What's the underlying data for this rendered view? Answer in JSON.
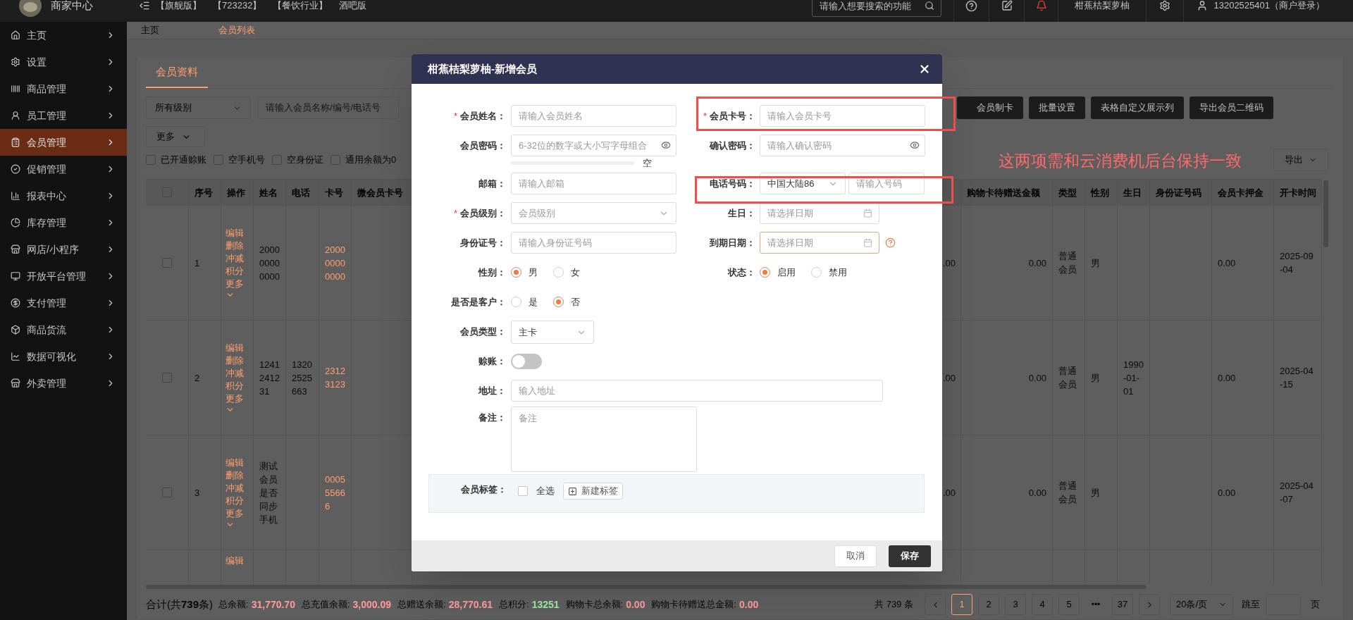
{
  "topbar": {
    "brand": "商家中心",
    "tags": [
      "【旗舰版】",
      "【723232】",
      "【餐饮行业】",
      "酒吧版"
    ],
    "search": {
      "placeholder": "请输入想要搜索的功能"
    },
    "store": "柑蕉桔梨萝柚",
    "user": "13202525401（商户登录）"
  },
  "sidebar": {
    "items": [
      {
        "label": "主页",
        "selected": false
      },
      {
        "label": "设置",
        "selected": false
      },
      {
        "label": "商品管理",
        "selected": false
      },
      {
        "label": "员工管理",
        "selected": false
      },
      {
        "label": "会员管理",
        "selected": true
      },
      {
        "label": "促销管理",
        "selected": false
      },
      {
        "label": "报表中心",
        "selected": false
      },
      {
        "label": "库存管理",
        "selected": false
      },
      {
        "label": "网店/小程序",
        "selected": false
      },
      {
        "label": "开放平台管理",
        "selected": false
      },
      {
        "label": "支付管理",
        "selected": false
      },
      {
        "label": "商品货流",
        "selected": false
      },
      {
        "label": "数据可视化",
        "selected": false
      },
      {
        "label": "外卖管理",
        "selected": false
      }
    ]
  },
  "breadcrumb": [
    {
      "label": "主页",
      "selected": false
    },
    {
      "label": "会员列表",
      "selected": true
    }
  ],
  "tabs": [
    {
      "label": "会员资料",
      "selected": true
    }
  ],
  "filters": {
    "level": "所有级别",
    "search": {
      "placeholder": "请输入会员名称/编号/电话号"
    },
    "more": "更多",
    "checks": [
      {
        "label": "已开通赊账",
        "checked": false
      },
      {
        "label": "空手机号",
        "checked": false
      },
      {
        "label": "空身份证",
        "checked": false
      },
      {
        "label": "通用余额为0",
        "checked": false
      }
    ]
  },
  "actions": [
    "会员制卡",
    "批量设置",
    "表格自定义展示列",
    "导出会员二维码"
  ],
  "export": "导出",
  "annotation": "这两项需和云消费机后台保持一致",
  "table": {
    "all_checked": false,
    "left_columns": [
      "序号",
      "操作",
      "姓名",
      "电话",
      "卡号",
      "微会员卡号"
    ],
    "right_columns": [
      "购物卡待赠送金额",
      "类型",
      "性别",
      "生日",
      "身份证号码",
      "会员卡押金",
      "开卡时间"
    ],
    "rows": [
      {
        "checked": false,
        "no": "1",
        "actions": [
          "编辑",
          "删除",
          "冲减积分",
          "更多"
        ],
        "more_menu": true,
        "name": "200000000000",
        "card": "200000000000",
        "partial": ".00",
        "gift": "0.00",
        "type": "普通会员",
        "gender": "男",
        "deposit": "0.00",
        "opened": "2025-09-04"
      },
      {
        "checked": false,
        "no": "2",
        "actions": [
          "编辑",
          "删除",
          "冲减积分",
          "更多"
        ],
        "more_menu": true,
        "name": "1241241231",
        "phone": "13202525663",
        "card": "23123123",
        "partial": ".00",
        "gift": "0.00",
        "type": "普通会员",
        "gender": "男",
        "birthday": "1990-01-01",
        "deposit": "0.00",
        "opened": "2025-04-15"
      },
      {
        "checked": false,
        "no": "3",
        "actions": [
          "编辑",
          "删除",
          "冲减积分",
          "更多"
        ],
        "more_menu": true,
        "name": "测试会员是否同步手机",
        "card": "000555666",
        "partial": ".00",
        "gift": "0.00",
        "type": "普通会员",
        "gender": "男",
        "deposit": "0.00",
        "opened": "2025-04-07"
      },
      {
        "actions": [
          "编辑"
        ]
      }
    ]
  },
  "footer": {
    "total": "合计(共**739**条)",
    "sums": [
      {
        "label": "总余额:",
        "value": "31,770.70",
        "color": "#ff9a9a"
      },
      {
        "label": "总充值余额:",
        "value": "3,000.09",
        "color": "#ff9a9a"
      },
      {
        "label": "总赠送余额:",
        "value": "28,770.61",
        "color": "#ff9a9a"
      },
      {
        "label": "总积分:",
        "value": "13251",
        "color": "#9fe6a0"
      },
      {
        "label": "购物卡总余额:",
        "value": "0.00",
        "color": "#ff9a9a"
      },
      {
        "label": "购物卡待赠送总金额:",
        "value": "0.00",
        "color": "#ff9a9a"
      }
    ],
    "pagination": {
      "count": "共 739 条",
      "pages": [
        {
          "kind": "page",
          "label": "1",
          "selected": true
        },
        {
          "kind": "page",
          "label": "2",
          "selected": false
        },
        {
          "kind": "page",
          "label": "3",
          "selected": false
        },
        {
          "kind": "page",
          "label": "4",
          "selected": false
        },
        {
          "kind": "page",
          "label": "5",
          "selected": false
        },
        {
          "kind": "ellipsis",
          "label": "•••",
          "selected": false
        },
        {
          "kind": "page",
          "label": "37",
          "selected": false
        }
      ],
      "page_size": "20条/页",
      "jump_label": "跳至",
      "page_unit": "页"
    }
  },
  "modal": {
    "title": "柑蕉桔梨萝柚-新增会员",
    "rows": [
      {
        "left": {
          "kind": "text",
          "label": "会员姓名：",
          "required_mark": "*",
          "placeholder": "请输入会员姓名"
        },
        "right": {
          "kind": "text",
          "label": "会员卡号：",
          "required_mark": "*",
          "placeholder": "请输入会员卡号"
        }
      },
      {
        "left": {
          "kind": "password",
          "label": "会员密码：",
          "placeholder": "6-32位的数字或大小写字母组合"
        },
        "right": {
          "kind": "password",
          "label": "确认密码：",
          "placeholder": "请输入确认密码"
        }
      },
      {
        "left": {
          "kind": "strength",
          "level": 0,
          "text": "空"
        }
      },
      {
        "left": {
          "kind": "text",
          "label": "邮箱：",
          "placeholder": "请输入邮箱"
        },
        "right": {
          "kind": "phone",
          "label": "电话号码：",
          "region": "中国大陆86",
          "placeholder": "请输入号码"
        }
      },
      {
        "left": {
          "kind": "select",
          "label": "会员级别：",
          "required_mark": "*",
          "placeholder": "会员级别"
        },
        "right": {
          "kind": "date",
          "label": "生日：",
          "placeholder": "请选择日期",
          "focused": false
        }
      },
      {
        "left": {
          "kind": "text",
          "label": "身份证号：",
          "placeholder": "请输入身份证号码"
        },
        "right": {
          "kind": "date",
          "label": "到期日期：",
          "placeholder": "请选择日期",
          "focused": true,
          "help": true
        }
      },
      {
        "left": {
          "kind": "radio",
          "label": "性别：",
          "options": [
            {
              "label": "男",
              "selected": true
            },
            {
              "label": "女",
              "selected": false
            }
          ]
        },
        "right": {
          "kind": "radio",
          "label": "状态：",
          "options": [
            {
              "label": "启用",
              "selected": true
            },
            {
              "label": "禁用",
              "selected": false
            }
          ]
        }
      },
      {
        "left": {
          "kind": "radio",
          "label": "是否是客户：",
          "options": [
            {
              "label": "是",
              "selected": false
            },
            {
              "label": "否",
              "selected": true
            }
          ]
        }
      },
      {
        "left": {
          "kind": "dropdown",
          "label": "会员类型：",
          "value": "主卡"
        }
      },
      {
        "left": {
          "kind": "toggle",
          "label": "赊账：",
          "on": false
        }
      },
      {
        "left": {
          "kind": "address",
          "label": "地址：",
          "placeholder": "输入地址"
        }
      },
      {
        "left": {
          "kind": "textarea",
          "label": "备注：",
          "placeholder": "备注"
        }
      },
      {
        "left": {
          "kind": "tags",
          "label": "会员标签：",
          "select_all": {
            "label": "全选",
            "checked": false
          },
          "new_tag": "新建标签"
        }
      }
    ],
    "cancel": "取消",
    "save": "保存"
  }
}
